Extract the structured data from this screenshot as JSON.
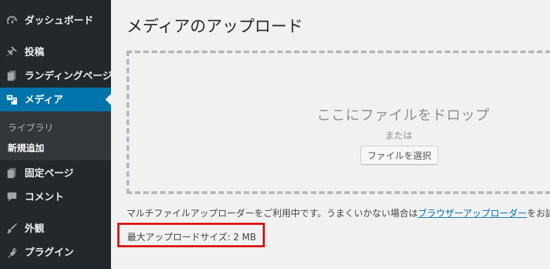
{
  "sidebar": {
    "items": [
      {
        "label": "ダッシュボード",
        "icon": "dashboard-icon"
      },
      {
        "label": "投稿",
        "icon": "pin-icon"
      },
      {
        "label": "ランディングページ",
        "icon": "pages-icon"
      },
      {
        "label": "メディア",
        "icon": "media-icon",
        "active": true
      },
      {
        "label": "固定ページ",
        "icon": "pages-icon"
      },
      {
        "label": "コメント",
        "icon": "comment-icon"
      },
      {
        "label": "外観",
        "icon": "brush-icon"
      },
      {
        "label": "プラグイン",
        "icon": "plugin-icon"
      }
    ],
    "submenu": [
      {
        "label": "ライブラリ"
      },
      {
        "label": "新規追加",
        "current": true
      }
    ]
  },
  "main": {
    "title": "メディアのアップロード",
    "drop_title": "ここにファイルをドロップ",
    "drop_or": "または",
    "select_button": "ファイルを選択",
    "help_prefix": "マルチファイルアップローダーをご利用中です。うまくいかない場合は",
    "help_link": "ブラウザーアップローダー",
    "help_suffix": "をお試",
    "max_size": "最大アップロードサイズ: 2 MB"
  },
  "colors": {
    "sidebar_bg": "#23282d",
    "submenu_bg": "#32373c",
    "active_bg": "#0073aa",
    "page_bg": "#f1f1f1",
    "link": "#0073aa",
    "highlight": "#e01010"
  }
}
